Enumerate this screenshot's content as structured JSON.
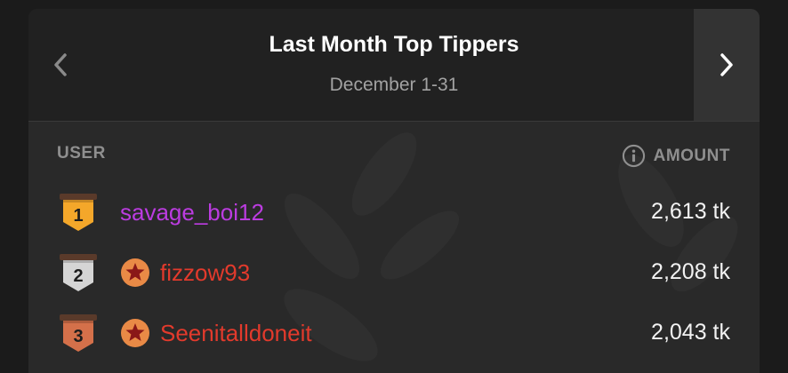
{
  "header": {
    "title": "Last Month Top Tippers",
    "subtitle": "December 1-31",
    "prev_icon": "chevron-left-icon",
    "next_icon": "chevron-right-icon"
  },
  "columns": {
    "user": "USER",
    "amount": "AMOUNT",
    "amount_icon": "info-icon"
  },
  "rows": [
    {
      "rank": "1",
      "name": "savage_boi12",
      "amount": "2,613 tk",
      "name_color": "#bb3ce0",
      "medal_color": "#f4a72a",
      "has_star": false
    },
    {
      "rank": "2",
      "name": "fizzow93",
      "amount": "2,208 tk",
      "name_color": "#e23a2c",
      "medal_color": "#d5d5d5",
      "has_star": true
    },
    {
      "rank": "3",
      "name": "Seenitalldoneit",
      "amount": "2,043 tk",
      "name_color": "#e23a2c",
      "medal_color": "#d4704a",
      "has_star": true
    }
  ],
  "colors": {
    "star_badge": "#e98a46",
    "star": "#8a1818"
  }
}
